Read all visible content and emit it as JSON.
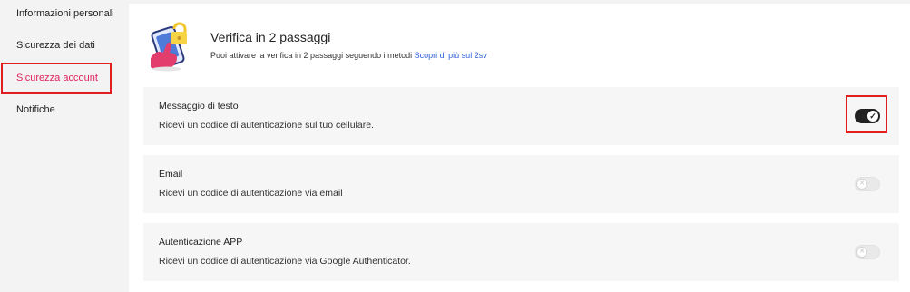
{
  "sidebar": {
    "items": [
      {
        "label": "Informazioni personali"
      },
      {
        "label": "Sicurezza dei dati"
      },
      {
        "label": "Sicurezza account"
      },
      {
        "label": "Notifiche"
      }
    ]
  },
  "header": {
    "title": "Verifica in 2 passaggi",
    "description": "Puoi attivare la verifica in 2 passaggi seguendo i metodi",
    "link": "Scopri di più sul 2sv"
  },
  "methods": [
    {
      "title": "Messaggio di testo",
      "description": "Ricevi un codice di autenticazione sul tuo cellulare.",
      "enabled": true
    },
    {
      "title": "Email",
      "description": "Ricevi un codice di autenticazione via email",
      "enabled": false
    },
    {
      "title": "Autenticazione APP",
      "description": "Ricevi un codice di autenticazione via Google Authenticator.",
      "enabled": false
    }
  ],
  "colors": {
    "accent": "#e0245e",
    "link": "#2e5fd8",
    "highlight": "#e02020",
    "toggle_on": "#222222"
  },
  "icons": {
    "header": "phone-lock-icon",
    "toggle_on": "check-icon",
    "toggle_off": "x-icon"
  }
}
